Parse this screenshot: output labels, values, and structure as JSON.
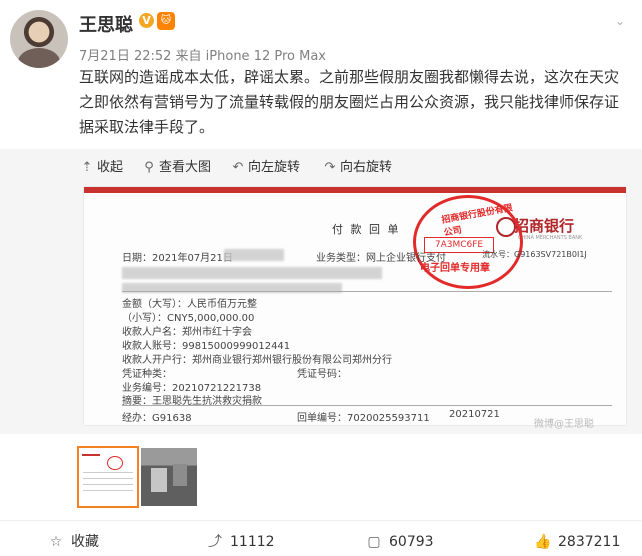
{
  "post": {
    "author": "王思聪",
    "meta": "7月21日 22:52 来自 iPhone 12 Pro Max",
    "text": "互联网的造谣成本太低，辟谣太累。之前那些假朋友圈我都懒得去说，这次在天灾之即依然有营销号为了流量转载假的朋友圈烂占用公众资源，我只能找律师保存证据采取法律手段了。",
    "badges": {
      "verified": "V",
      "fan": "🐱"
    }
  },
  "toolbar": {
    "collapse": "收起",
    "view_large": "查看大图",
    "rotate_left": "向左旋转",
    "rotate_right": "向右旋转"
  },
  "document": {
    "title": "付 款 回 单",
    "bank_name": "招商银行",
    "bank_en": "CHINA MERCHANTS BANK",
    "stamp_top": "招商银行股份有限公司",
    "stamp_id": "7A3MC6FE",
    "stamp_bottom": "电子回单专用章",
    "date_line": "日期：2021年07月21日",
    "business_type": "业务类型：网上企业银行支付",
    "serial_no": "流水号：G9163SV721B0I1J",
    "amount_upper": "金额（大写）：人民币佰万元整",
    "amount_lower": "（小写）：CNY5,000,000.00",
    "payee_name": "收款人户名：郑州市红十字会",
    "payee_account": "收款人账号：99815000999012441",
    "payee_bank": "收款人开户行：郑州商业银行郑州银行股份有限公司郑州分行",
    "voucher_type": "凭证种类：",
    "voucher_no": "凭证号码：",
    "business_no": "业务编号：20210721221738",
    "memo": "摘要：王思聪先生抗洪救灾捐款",
    "handler": "经办：G91638",
    "receipt_no": "回单编号：7020025593711",
    "print_date": "20210721"
  },
  "watermark": "微博@王思聪",
  "actions": {
    "favorite": "收藏",
    "share": "11112",
    "comment": "60793",
    "like": "2837211"
  }
}
